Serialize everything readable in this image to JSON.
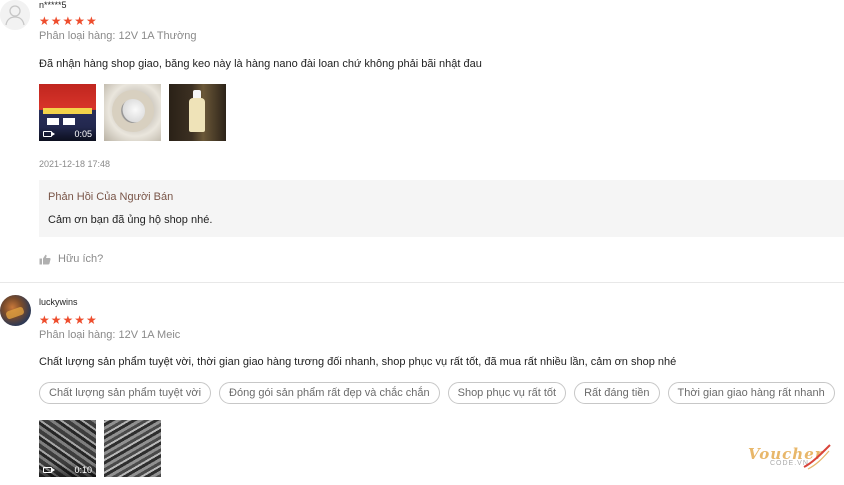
{
  "reviews": [
    {
      "username": "n*****5",
      "rating_text": "★★★★★",
      "rating": 5,
      "variant": "Phân loại hàng: 12V 1A Thường",
      "comment": "Đã nhận hàng shop giao, băng keo này là hàng nano đài loan chứ không phải bãi nhật đau",
      "media": [
        {
          "type": "video",
          "duration": "0:05"
        },
        {
          "type": "image"
        },
        {
          "type": "image"
        }
      ],
      "timestamp": "2021-12-18 17:48",
      "seller_reply": {
        "title": "Phản Hồi Của Người Bán",
        "text": "Cảm ơn bạn đã ủng hộ shop nhé."
      },
      "helpful_label": "Hữu ích?"
    },
    {
      "username": "luckywins",
      "rating_text": "★★★★★",
      "rating": 5,
      "variant": "Phân loại hàng: 12V 1A Meic",
      "comment": "Chất lượng sản phẩm tuyệt vời, thời gian giao hàng tương đối nhanh, shop phục vụ rất tốt, đã mua rất nhiều lần, cảm ơn shop nhé",
      "tags": [
        "Chất lượng sản phẩm tuyệt vời",
        "Đóng gói sản phẩm rất đẹp và chắc chắn",
        "Shop phục vụ rất tốt",
        "Rất đáng tiền",
        "Thời gian giao hàng rất nhanh"
      ],
      "media": [
        {
          "type": "video",
          "duration": "0:10"
        },
        {
          "type": "image"
        }
      ]
    }
  ],
  "watermark": {
    "main": "Voucher",
    "sub": "CODE.VN"
  },
  "colors": {
    "star": "#ee4d2d",
    "reply_bg": "#f5f5f5",
    "reply_title": "#795548",
    "muted": "#8a8a8a"
  }
}
